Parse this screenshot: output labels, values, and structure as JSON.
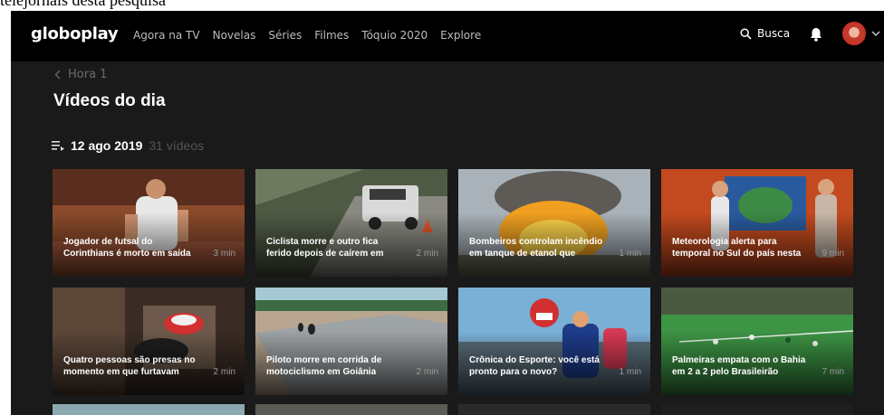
{
  "top_caption": "telejornais desta pesquisa",
  "nav": {
    "logo": "globoplay",
    "links": [
      "Agora na TV",
      "Novelas",
      "Séries",
      "Filmes",
      "Tóquio 2020",
      "Explore"
    ],
    "search_label": "Busca"
  },
  "breadcrumb": "Hora 1",
  "page_title": "Vídeos do dia",
  "date": "12 ago 2019",
  "video_count": "31 vídeos",
  "cards": [
    {
      "title": "Jogador de futsal do Corinthians é morto em saída",
      "duration": "3 min"
    },
    {
      "title": "Ciclista morre e outro fica ferido depois de caírem em",
      "duration": "2 min"
    },
    {
      "title": "Bombeiros controlam incêndio em tanque de etanol que",
      "duration": "1 min"
    },
    {
      "title": "Meteorologia alerta para temporal no Sul do país nesta",
      "duration": "9 min"
    },
    {
      "title": "Quatro pessoas são presas no momento em que furtavam",
      "duration": "2 min"
    },
    {
      "title": "Piloto morre em corrida de motociclismo em Goiânia",
      "duration": "2 min"
    },
    {
      "title": "Crônica do Esporte: você está pronto para o novo?",
      "duration": "1 min"
    },
    {
      "title": "Palmeiras empata com o Bahia em 2 a 2 pelo Brasileirão",
      "duration": "7 min"
    }
  ]
}
